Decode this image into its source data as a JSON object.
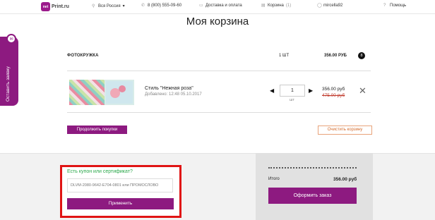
{
  "nav": {
    "logo_mark": "net",
    "logo_text": "Print.ru",
    "region": "Вся Россия",
    "phone": "8 (800) 555-09-60",
    "delivery": "Доставка и оплата",
    "cart": "Корзина",
    "cart_count": "(1)",
    "user": "mircella92",
    "help": "Помощь"
  },
  "side_tab": {
    "label": "Оставить заявку"
  },
  "page": {
    "title": "Моя корзина"
  },
  "product_group": {
    "name": "ФОТОКРУЖКА",
    "qty": "1 ШТ",
    "sum": "356.00 РУБ",
    "badge": "8"
  },
  "item": {
    "style": "Стиль \"Нежная роза\"",
    "added": "Добавлено: 12:48 05.10.2017",
    "quantity": "1",
    "unit": "шт",
    "price": "356.00 руб",
    "old_price": "475.00 руб"
  },
  "buttons": {
    "continue": "Продолжить покупки",
    "clear": "Очистить корзину"
  },
  "coupon": {
    "title": "Есть купон или сертификат?",
    "placeholder": "DLVM-2080-9642-E704-0801 или ПРОМОСЛОВО",
    "apply": "Применить"
  },
  "summary": {
    "total_label": "Итого",
    "total_value": "356.00 руб",
    "order": "Оформить заказ"
  },
  "colors": {
    "accent": "#8d1a80",
    "highlight": "#e01414",
    "link_green": "#2aa84a"
  }
}
